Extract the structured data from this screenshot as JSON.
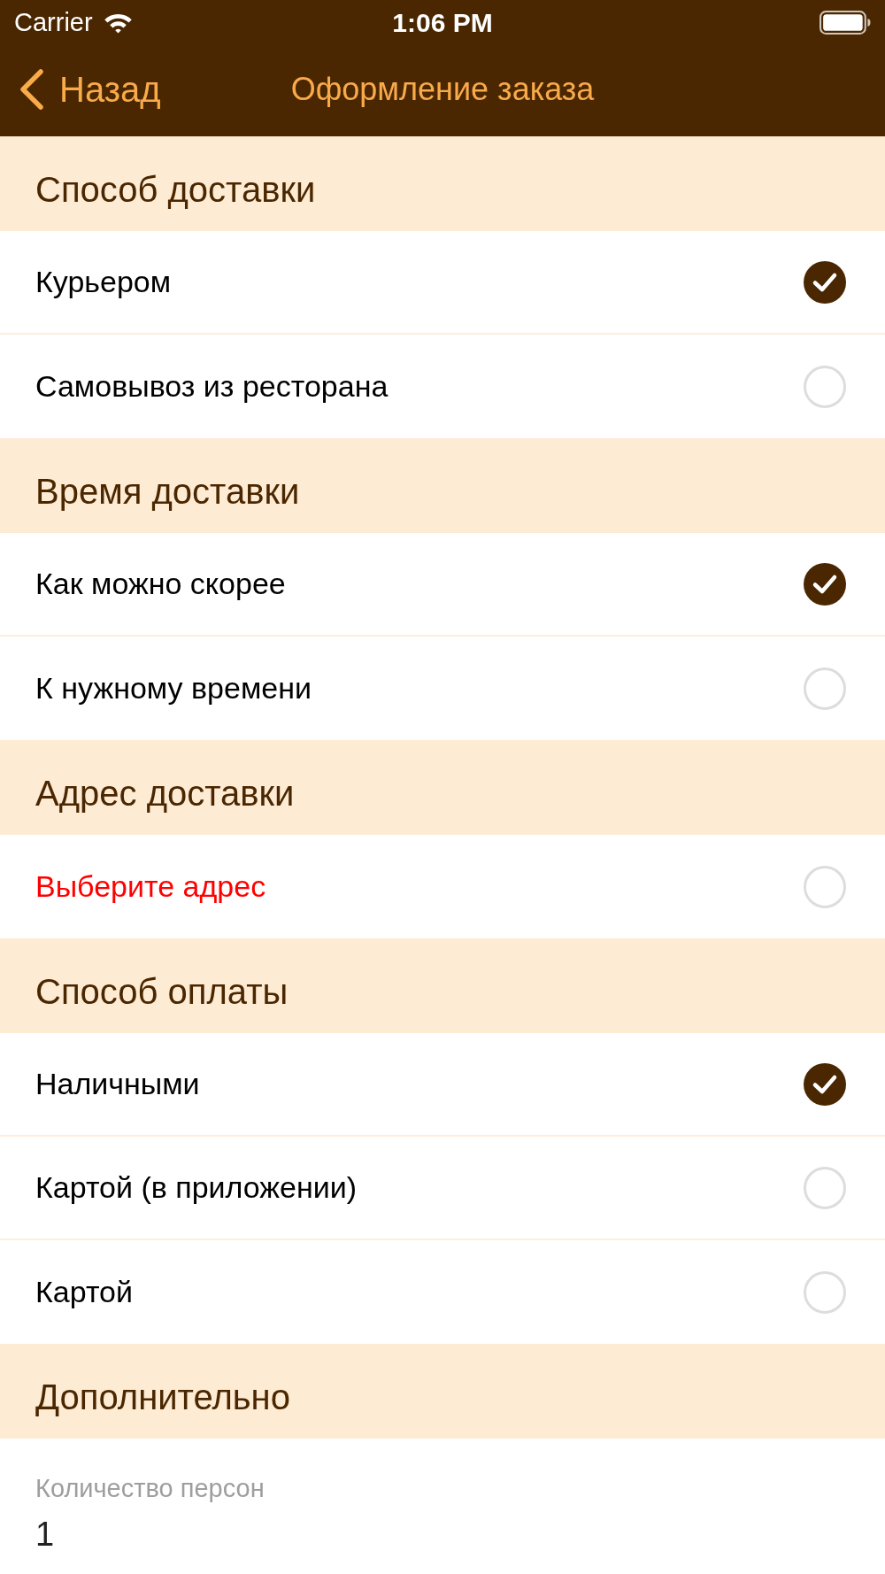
{
  "status_bar": {
    "carrier": "Carrier",
    "time": "1:06 PM"
  },
  "nav_bar": {
    "back": "Назад",
    "title": "Оформление заказа"
  },
  "sections": [
    {
      "title": "Способ доставки",
      "options": [
        {
          "label": "Курьером",
          "selected": true,
          "kind": "option"
        },
        {
          "label": "Самовывоз из ресторана",
          "selected": false,
          "kind": "option"
        }
      ]
    },
    {
      "title": "Время доставки",
      "options": [
        {
          "label": "Как можно скорее",
          "selected": true,
          "kind": "option"
        },
        {
          "label": "К нужному времени",
          "selected": false,
          "kind": "option"
        }
      ]
    },
    {
      "title": "Адрес доставки",
      "options": [
        {
          "label": "Выберите адрес",
          "selected": false,
          "kind": "prompt"
        }
      ]
    },
    {
      "title": "Способ оплаты",
      "options": [
        {
          "label": "Наличными",
          "selected": true,
          "kind": "option"
        },
        {
          "label": "Картой (в приложении)",
          "selected": false,
          "kind": "option"
        },
        {
          "label": "Картой",
          "selected": false,
          "kind": "option"
        }
      ]
    },
    {
      "title": "Дополнительно",
      "fields": [
        {
          "label": "Количество персон",
          "value": "1"
        }
      ]
    }
  ]
}
